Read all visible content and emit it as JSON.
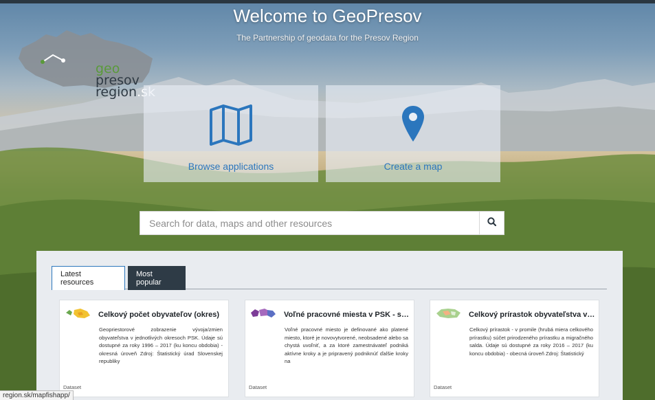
{
  "header": {
    "title": "Welcome to GeoPresov",
    "subtitle": "The Partnership of geodata for the Presov Region"
  },
  "logo": {
    "line1": "geo",
    "line2": "presov",
    "line3": "region",
    "suffix": ".sk"
  },
  "tiles": {
    "browse": {
      "label": "Browse applications",
      "icon": "map-icon"
    },
    "create": {
      "label": "Create a map",
      "icon": "map-pin-icon"
    }
  },
  "search": {
    "placeholder": "Search for data, maps and other resources",
    "icon": "search-icon"
  },
  "tabs": {
    "latest": "Latest resources",
    "popular": "Most popular"
  },
  "cards": [
    {
      "title": "Celkový počet obyvateľov (okres)",
      "description": "Geopriestorové zobrazenie vývoja/zmien obyvateľstva v jednotlivých okresoch PSK. Údaje sú dostupné za roky 1996 – 2017 (ku koncu obdobia) - okresná úroveň Zdroj: Štatistický úrad Slovenskej republiky",
      "type": "Dataset"
    },
    {
      "title": "Voľné pracovné miesta v PSK - sp...",
      "description": "Voľné pracovné miesto je definované ako platené miesto, ktoré je novovytvorené, neobsadené alebo sa chystá uvoľniť, a za ktoré zamestnávateľ podniká aktívne kroky a je pripravený podniknúť ďalšie kroky na",
      "type": "Dataset"
    },
    {
      "title": "Celkový prírastok obyvateľstva v ...",
      "description": "Celkový prírastok - v promile (hrubá miera celkového prírastku) súčet prirodzeného prírastku a migračného salda. Údaje sú dostupné za roky 2016 – 2017 (ku koncu obdobia) - obecná úroveň Zdroj: Štatistický",
      "type": "Dataset"
    }
  ],
  "status_url": "region.sk/mapfishapp/",
  "colors": {
    "accent": "#2b76bd",
    "dark_tab": "#2e3b46",
    "panel_bg": "#e9ecf0"
  }
}
